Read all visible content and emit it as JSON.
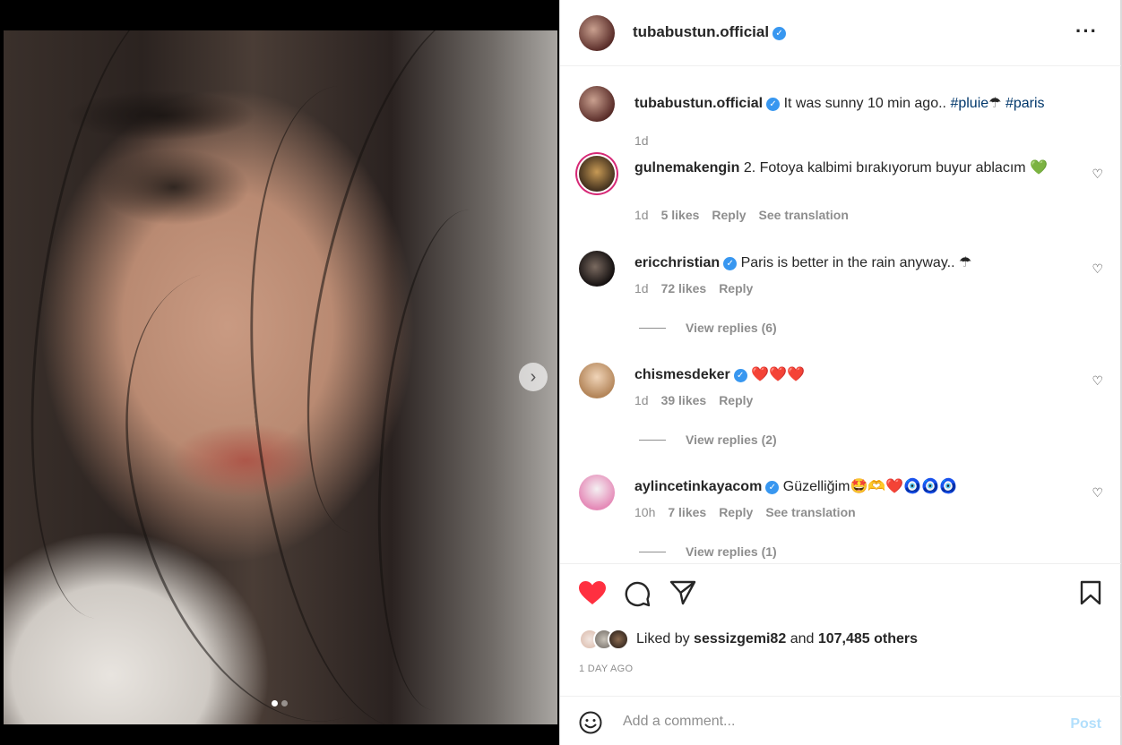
{
  "post": {
    "author": "tubabustun.official",
    "slide_count": 2,
    "active_slide": 1
  },
  "caption": {
    "username": "tubabustun.official",
    "text": "It was sunny 10 min ago..",
    "hashtag1": "#pluie",
    "emoji": "☂",
    "hashtag2": "#paris",
    "time": "1d"
  },
  "comments": [
    {
      "username": "gulnemakengin",
      "verified": false,
      "text": "2. Fotoya kalbimi bırakıyorum buyur ablacım 💚",
      "time": "1d",
      "likes": "5 likes",
      "reply": "Reply",
      "translate": "See translation"
    },
    {
      "username": "ericchristian",
      "verified": true,
      "text": "Paris is better in the rain anyway.. ☂",
      "time": "1d",
      "likes": "72 likes",
      "reply": "Reply",
      "view_replies": "View replies (6)"
    },
    {
      "username": "chismesdeker",
      "verified": true,
      "text": "❤️❤️❤️",
      "time": "1d",
      "likes": "39 likes",
      "reply": "Reply",
      "view_replies": "View replies (2)"
    },
    {
      "username": "aylincetinkayacom",
      "verified": true,
      "text": "Güzelliğim🤩🫶❤️🧿🧿🧿",
      "time": "10h",
      "likes": "7 likes",
      "reply": "Reply",
      "translate": "See translation",
      "view_replies": "View replies (1)"
    }
  ],
  "likes": {
    "prefix": "Liked by",
    "user": "sessizgemi82",
    "and": "and",
    "others": "107,485 others"
  },
  "date": "1 DAY AGO",
  "add_comment": {
    "placeholder": "Add a comment...",
    "post_label": "Post"
  },
  "colors": {
    "like_red": "#ff3040",
    "link_blue": "#00376b",
    "verified_blue": "#3897f0",
    "muted": "#8e8e8e",
    "post_disabled": "#b2dffc"
  }
}
